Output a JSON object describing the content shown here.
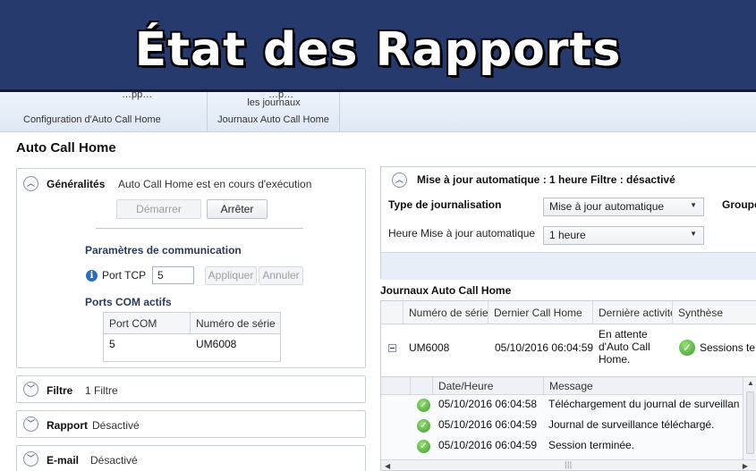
{
  "banner": {
    "title": "État des Rapports"
  },
  "ribbon": {
    "group1_partial": "…pp…",
    "group1_label": "Configuration d'Auto Call Home",
    "group2_button_partial": "…p…",
    "group2_button_line2": "les journaux",
    "group2_label": "Journaux Auto Call Home"
  },
  "page_title": "Auto Call Home",
  "general": {
    "label": "Généralités",
    "status": "Auto Call Home est en cours d'exécution",
    "start_label": "Démarrer",
    "stop_label": "Arrêter",
    "comm_title": "Paramètres de communication",
    "tcp_label": "Port TCP",
    "tcp_value": "5",
    "apply_label": "Appliquer",
    "cancel_label": "Annuler",
    "com_title": "Ports COM actifs",
    "com_headers": [
      "Port COM",
      "Numéro de série"
    ],
    "com_rows": [
      [
        "5",
        "UM6008"
      ]
    ]
  },
  "filtre": {
    "label": "Filtre",
    "status": "1 Filtre"
  },
  "rapport": {
    "label": "Rapport",
    "status": "Désactivé"
  },
  "email": {
    "label": "E-mail",
    "status": "Désactivé"
  },
  "right": {
    "header": "Mise à jour automatique : 1 heure   Filtre : désactivé",
    "log_type_label": "Type de journalisation",
    "log_type_value": "Mise à jour automatique",
    "group_label": "Groupe",
    "hour_label": "Heure Mise à jour automatique",
    "hour_value": "1 heure"
  },
  "journaux": {
    "title": "Journaux Auto Call Home",
    "headers": [
      "Numéro de série",
      "Dernier Call Home",
      "Dernière activité",
      "Synthèse"
    ],
    "row": {
      "serial": "UM6008",
      "last_call": "05/10/2016 06:04:59",
      "activity_lines": [
        "En attente",
        "d'Auto Call",
        "Home."
      ],
      "summary": "Sessions te"
    },
    "sub_headers": [
      "Date/Heure",
      "Message"
    ],
    "sub_rows": [
      {
        "date": "05/10/2016 06:04:58",
        "message": "Téléchargement du journal de surveillan"
      },
      {
        "date": "05/10/2016 06:04:59",
        "message": "Journal de surveillance téléchargé."
      },
      {
        "date": "05/10/2016 06:04:59",
        "message": "Session terminée."
      }
    ]
  },
  "icons": {
    "check": "green-check-icon",
    "info": "info-icon",
    "collapse": "chevron-up-icon",
    "expand": "chevron-down-icon"
  }
}
